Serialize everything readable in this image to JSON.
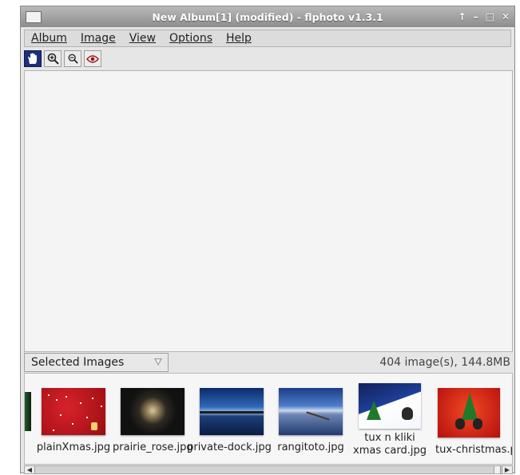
{
  "window": {
    "title": "New Album[1] (modified) - flphoto v1.3.1",
    "controls": [
      "↑",
      "–",
      "□",
      "✕"
    ]
  },
  "menu": [
    "Album",
    "Image",
    "View",
    "Options",
    "Help"
  ],
  "toolbar": [
    {
      "icon": "hand-icon",
      "active": true
    },
    {
      "icon": "zoom-in-icon",
      "active": false
    },
    {
      "icon": "zoom-out-icon",
      "active": false
    },
    {
      "icon": "eye-icon",
      "active": false
    }
  ],
  "status": {
    "selector_value": "Selected Images",
    "image_count": "404 image(s), 144.8MB"
  },
  "thumbnails": [
    {
      "label": "plainXmas.jpg"
    },
    {
      "label": "prairie_rose.jpg"
    },
    {
      "label": "private-dock.jpg"
    },
    {
      "label": "rangitoto.jpg"
    },
    {
      "label": "tux n kliki xmas card.jpg"
    },
    {
      "label": "tux-christmas.png"
    }
  ]
}
